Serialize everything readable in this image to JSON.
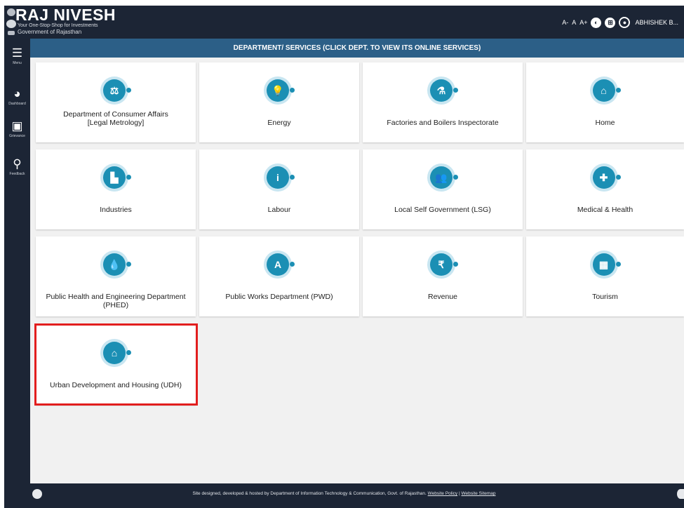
{
  "header": {
    "brand": "RAJ NIVESH",
    "tagline": "Your One-Stop-Shop for Investments",
    "subtitle": "Government of Rajasthan",
    "font_controls": [
      "A-",
      "A",
      "A+"
    ],
    "user_name": "ABHISHEK B..."
  },
  "sidebar": {
    "items": [
      {
        "label": "Menu",
        "icon": "menu-icon"
      },
      {
        "label": "Dashboard",
        "icon": "dashboard-icon"
      },
      {
        "label": "Grievance",
        "icon": "grievance-icon"
      },
      {
        "label": "Feedback",
        "icon": "feedback-icon"
      }
    ]
  },
  "main": {
    "title": "DEPARTMENT/ SERVICES (CLICK DEPT. TO VIEW ITS ONLINE SERVICES)",
    "departments": [
      {
        "label": "Department of Consumer Affairs\n[Legal Metrology]",
        "icon": "scales-icon",
        "glyph": "⚖"
      },
      {
        "label": "Energy",
        "icon": "bulb-icon",
        "glyph": "💡"
      },
      {
        "label": "Factories and Boilers Inspectorate",
        "icon": "flask-icon",
        "glyph": "⚗"
      },
      {
        "label": "Home",
        "icon": "home-icon",
        "glyph": "⌂"
      },
      {
        "label": "Industries",
        "icon": "factory-icon",
        "glyph": "▙"
      },
      {
        "label": "Labour",
        "icon": "worker-icon",
        "glyph": "i"
      },
      {
        "label": "Local Self Government (LSG)",
        "icon": "people-icon",
        "glyph": "👥"
      },
      {
        "label": "Medical & Health",
        "icon": "medical-kit-icon",
        "glyph": "✚"
      },
      {
        "label": "Public Health and Engineering Department (PHED)",
        "icon": "water-hand-icon",
        "glyph": "💧"
      },
      {
        "label": "Public Works Department (PWD)",
        "icon": "road-icon",
        "glyph": "A"
      },
      {
        "label": "Revenue",
        "icon": "rupee-icon",
        "glyph": "₹"
      },
      {
        "label": "Tourism",
        "icon": "building-icon",
        "glyph": "▦"
      },
      {
        "label": "Urban Development and Housing (UDH)",
        "icon": "home-icon",
        "glyph": "⌂"
      }
    ]
  },
  "footer": {
    "text": "Site designed, developed & hosted by Department of Information Technology & Communication, Govt. of Rajasthan.",
    "link_policy": "Website Policy",
    "separator": "|",
    "link_sitemap": "Website Sitemap"
  },
  "colors": {
    "header_bg": "#1c2535",
    "title_bar": "#2c5f87",
    "icon_accent": "#1b8fb4",
    "highlight": "#e21e1e"
  }
}
